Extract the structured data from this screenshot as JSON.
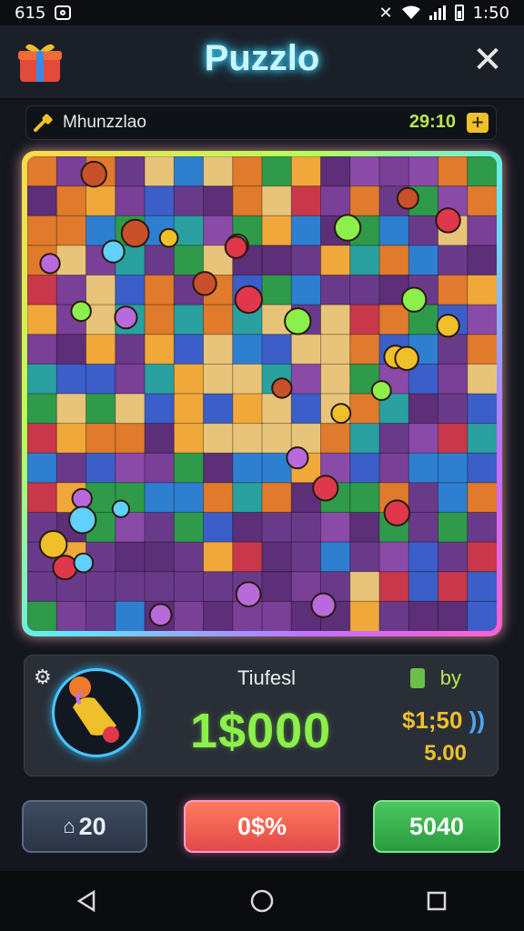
{
  "status_bar": {
    "time_left": "615",
    "time_right": "1:50"
  },
  "header": {
    "title": "Puzzlo"
  },
  "info_bar": {
    "puzzle_name": "Mhunzzlao",
    "timer": "29:10",
    "plus_label": "+"
  },
  "board": {
    "rows": 16,
    "cols": 16,
    "palette": [
      "#6a3a8a",
      "#7a3f96",
      "#5c2f78",
      "#2f7fd0",
      "#3b5ec8",
      "#e07a2c",
      "#f0a83a",
      "#e8c47a",
      "#2f9a4a",
      "#c8384a",
      "#2aa0a0",
      "#8a4aa8"
    ]
  },
  "panel": {
    "mode_label": "Tiufesl",
    "score": "1$000",
    "buy_label": "by",
    "price": "$1;50",
    "price_suffix": "))",
    "sub_value": "5.00"
  },
  "buttons": {
    "home_value": "20",
    "middle_value": "0$%",
    "right_value": "5040"
  },
  "colors": {
    "accent_cyan": "#3fd8ff",
    "score_green": "#8cf04a",
    "gold": "#f0c02a"
  }
}
